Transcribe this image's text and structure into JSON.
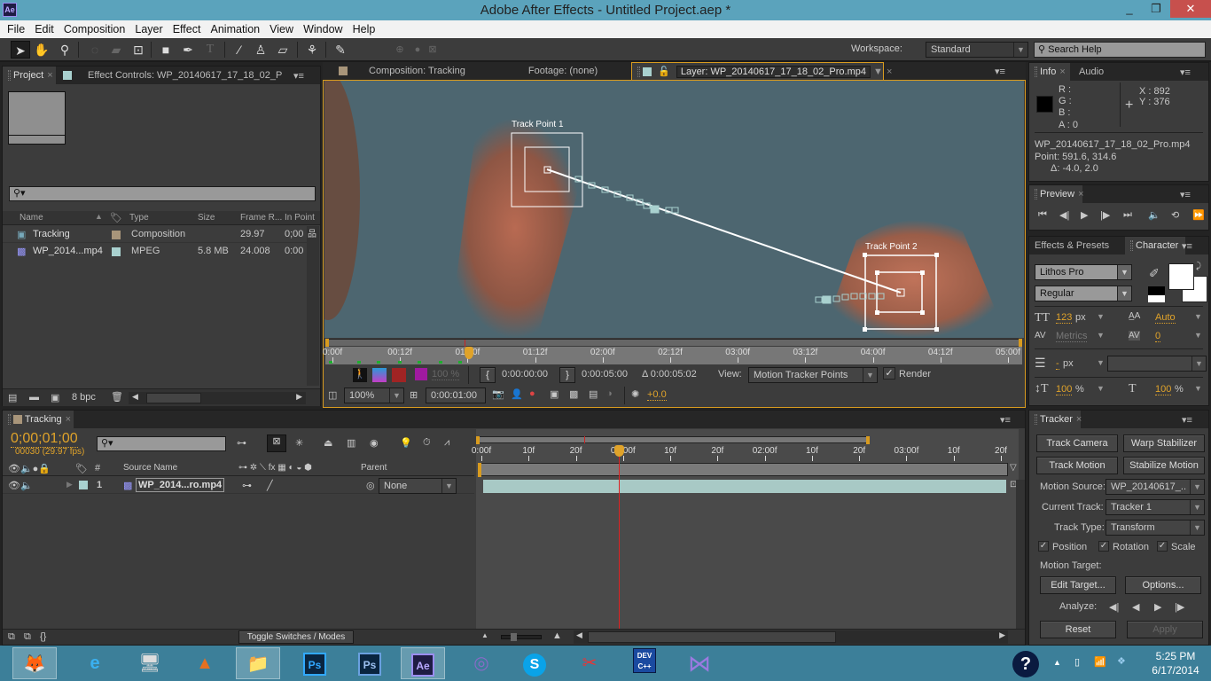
{
  "window": {
    "title": "Adobe After Effects - Untitled Project.aep *",
    "app_icon": "Ae",
    "minimize": "_",
    "restore": "❐",
    "close": "✕"
  },
  "menubar": [
    "File",
    "Edit",
    "Composition",
    "Layer",
    "Effect",
    "Animation",
    "View",
    "Window",
    "Help"
  ],
  "toolbar": {
    "tools": [
      "selection-tool",
      "hand-tool",
      "zoom-tool",
      "rotation-tool",
      "camera-tool",
      "pan-behind-tool",
      "rectangle-tool",
      "pen-tool",
      "type-tool",
      "brush-tool",
      "clone-stamp-tool",
      "eraser-tool",
      "roto-brush-tool",
      "puppet-pin-tool"
    ],
    "workspace_label": "Workspace:",
    "workspace_value": "Standard",
    "search_placeholder": "Search Help"
  },
  "project_panel": {
    "tab_project": "Project",
    "tab_effect_controls": "Effect Controls: WP_20140617_17_18_02_P",
    "columns": [
      "Name",
      "Type",
      "Size",
      "Frame R...",
      "In Point"
    ],
    "items": [
      {
        "name": "Tracking",
        "label_color": "#a8957a",
        "type": "Composition",
        "size": "",
        "frame_rate": "29.97",
        "in_point": "0;00"
      },
      {
        "name": "WP_2014...mp4",
        "label_color": "#a9d1cf",
        "type": "MPEG",
        "size": "5.8 MB",
        "frame_rate": "24.008",
        "in_point": "0:00"
      }
    ],
    "bpc": "8 bpc"
  },
  "viewer": {
    "tab_composition": "Composition: Tracking",
    "tab_footage": "Footage: (none)",
    "tab_layer": "Layer: WP_20140617_17_18_02_Pro.mp4",
    "track_point_1": "Track Point 1",
    "track_point_2": "Track Point 2",
    "ruler_labels": [
      "0:00f",
      "00:12f",
      "01:00f",
      "01:12f",
      "02:00f",
      "02:12f",
      "03:00f",
      "03:12f",
      "04:00f",
      "04:12f",
      "05:00f"
    ],
    "opacity": "100 %",
    "in_time": "0:00:00:00",
    "out_time": "0:00:05:00",
    "duration": "Δ 0:00:05:02",
    "view_label": "View:",
    "view_value": "Motion Tracker Points",
    "render_label": "Render",
    "zoom": "100%",
    "current_time": "0:00:01:00",
    "exposure": "+0.0"
  },
  "info_panel": {
    "tab_info": "Info",
    "tab_audio": "Audio",
    "r": "R :",
    "g": "G :",
    "b": "B :",
    "a": "A :  0",
    "x": "X : 892",
    "y": "Y : 376",
    "file": "WP_20140617_17_18_02_Pro.mp4",
    "point": "Point: 591.6, 314.6",
    "delta": "Δ: -4.0, 2.0"
  },
  "preview_panel": {
    "tab": "Preview"
  },
  "character_panel": {
    "tab_effects": "Effects & Presets",
    "tab_character": "Character",
    "font": "Lithos Pro",
    "style": "Regular",
    "size_value": "123",
    "size_unit": "px",
    "leading": "Auto",
    "kerning": "Metrics",
    "tracking": "0",
    "stroke_value": "-",
    "stroke_unit": "px",
    "vscale": "100",
    "hscale": "100",
    "pct": "%"
  },
  "timeline": {
    "tab": "Tracking",
    "timecode": "0;00;01;00",
    "frames": "00030 (29.97 fps)",
    "columns": {
      "num": "#",
      "source": "Source Name",
      "parent": "Parent"
    },
    "layers": [
      {
        "num": "1",
        "name": "WP_2014...ro.mp4",
        "parent": "None"
      }
    ],
    "ruler": [
      "0:00f",
      "10f",
      "20f",
      "01:00f",
      "10f",
      "20f",
      "02:00f",
      "10f",
      "20f",
      "03:00f",
      "10f",
      "20f"
    ],
    "toggle": "Toggle Switches / Modes"
  },
  "tracker_panel": {
    "tab": "Tracker",
    "track_camera": "Track Camera",
    "warp_stabilizer": "Warp Stabilizer",
    "track_motion": "Track Motion",
    "stabilize_motion": "Stabilize Motion",
    "motion_source_label": "Motion Source:",
    "motion_source": "WP_20140617_..",
    "current_track_label": "Current Track:",
    "current_track": "Tracker 1",
    "track_type_label": "Track Type:",
    "track_type": "Transform",
    "position": "Position",
    "rotation": "Rotation",
    "scale": "Scale",
    "motion_target": "Motion Target:",
    "edit_target": "Edit Target...",
    "options": "Options...",
    "analyze": "Analyze:",
    "reset": "Reset",
    "apply": "Apply"
  },
  "taskbar": {
    "apps": [
      "firefox",
      "internet-explorer",
      "resource-monitor",
      "matlab",
      "file-explorer",
      "photoshop",
      "photoshop-2",
      "after-effects",
      "bittorrent",
      "skype",
      "snipping-tool",
      "dev-cpp",
      "visual-studio"
    ],
    "time": "5:25 PM",
    "date": "6/17/2014"
  }
}
